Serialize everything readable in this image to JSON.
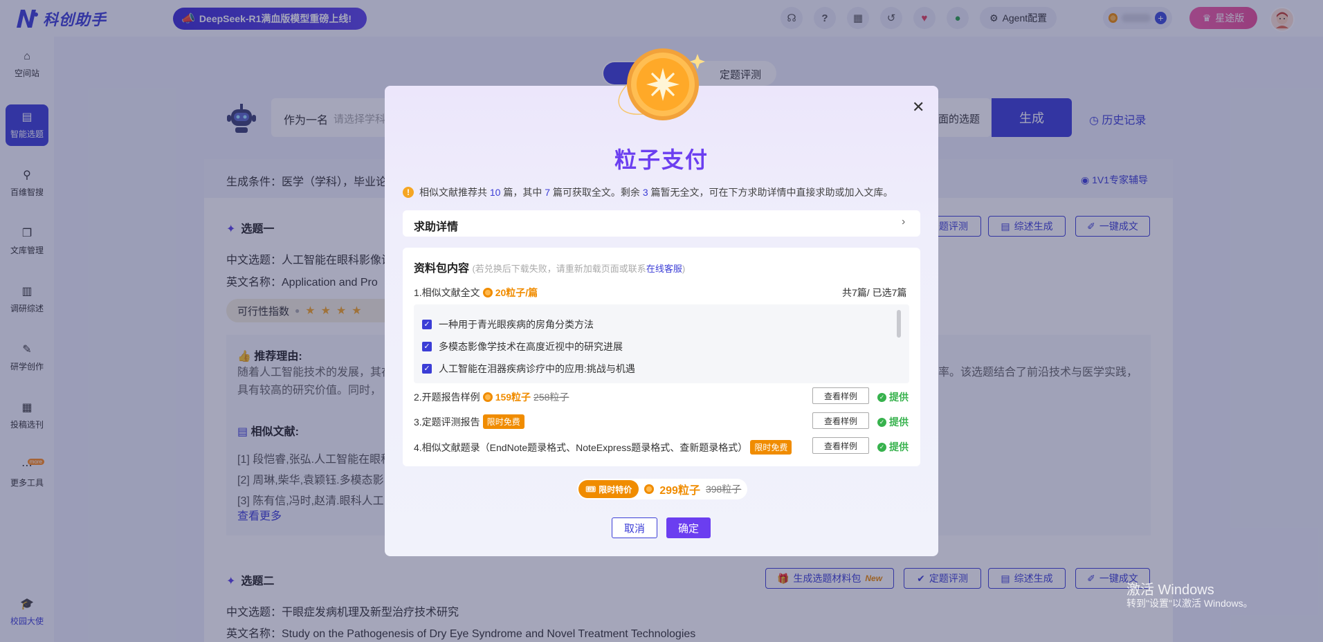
{
  "app": {
    "name": "科创助手",
    "promo": "DeepSeek-R1满血版模型重磅上线!"
  },
  "topbar": {
    "icons": [
      "headset-icon",
      "help-icon",
      "calendar-icon",
      "history-icon",
      "heart-icon",
      "wechat-icon"
    ],
    "agent_label": "Agent配置",
    "vip_label": "星途版"
  },
  "sidebar": {
    "items": [
      {
        "label": "空间站",
        "icon": "⌂"
      },
      {
        "label": "智能选题",
        "icon": "▤"
      },
      {
        "label": "百维智搜",
        "icon": "⚲"
      },
      {
        "label": "文库管理",
        "icon": "❐"
      },
      {
        "label": "调研综述",
        "icon": "▥"
      },
      {
        "label": "研学创作",
        "icon": "✎"
      },
      {
        "label": "投稿选刊",
        "icon": "▦"
      },
      {
        "label": "更多工具",
        "icon": "⋯"
      },
      {
        "label": "校园大使",
        "icon": "🎓"
      }
    ],
    "more_tag": "more"
  },
  "page": {
    "toggle_label": "定题评测",
    "role_prefix": "作为一名",
    "role_placeholder": "请选择学科",
    "search_tail": "面的选题",
    "generate_label": "生成",
    "history_label": "历史记录",
    "condition": "生成条件：医学（学科），毕业论",
    "expert": "1V1专家辅导",
    "topic1": {
      "title": "选题一",
      "cn_prefix": "中文选题：人工智能在眼科影像诊",
      "en_prefix": "英文名称：Application and Pro",
      "feasibility": "可行性指数",
      "reason_title": "推荐理由:",
      "reason_line1": "随着人工智能技术的发展，其在",
      "reason_line1_tail": "率。该选题结合了前沿技术与医学实践，",
      "reason_line2": "具有较高的研究价值。同时，",
      "similar_title": "相似文献:",
      "refs": [
        "[1] 段恺睿,张弘.人工智能在眼科",
        "[2] 周琳,柴华,袁颖钰.多模态影",
        "[3] 陈有信,冯时,赵清.眼科人工"
      ],
      "more": "查看更多",
      "actions": [
        "题评测",
        "综述生成",
        "一键成文"
      ]
    },
    "topic2": {
      "title": "选题二",
      "cn": "中文选题：干眼症发病机理及新型治疗技术研究",
      "en": "英文名称：Study on the Pathogenesis of Dry Eye Syndrome and Novel Treatment Technologies",
      "actions": [
        "生成选题材料包",
        "定题评测",
        "综述生成",
        "一键成文"
      ],
      "new_tag": "New"
    },
    "watermark_title": "激活 Windows",
    "watermark_sub": "转到\"设置\"以激活 Windows。"
  },
  "modal": {
    "title": "粒子支付",
    "notice": {
      "p1": "相似文献推荐共",
      "total": "10",
      "p2": "篇，其中",
      "full": "7",
      "p3": "篇可获取全文。剩余",
      "rest": "3",
      "p4": "篇暂无全文，可在下方求助详情中直接求助或加入文库。"
    },
    "help_label": "求助详情",
    "pack_title": "资料包内容",
    "pack_hint_pre": "(若兑换后下载失败，请重新加载页面或联系",
    "pack_hint_link": "在线客服",
    "pack_hint_post": ")",
    "item1": {
      "label": "1.相似文献全文",
      "price": "20粒子/篇",
      "count": "共7篇/ 已选7篇"
    },
    "papers": [
      "一种用于青光眼疾病的房角分类方法",
      "多模态影像学技术在高度近视中的研究进展",
      "人工智能在泪器疾病诊疗中的应用:挑战与机遇"
    ],
    "item2": {
      "label": "2.开题报告样例",
      "price": "159粒子",
      "old": "258粒子"
    },
    "item3": {
      "label": "3.定题评测报告",
      "tag": "限时免费"
    },
    "item4": {
      "label": "4.相似文献题录（EndNote题录格式、NoteExpress题录格式、查新题录格式）",
      "tag": "限时免费"
    },
    "sample_label": "查看样例",
    "provide_label": "提供",
    "promo_label": "限时特价",
    "price_now": "299粒子",
    "price_old": "398粒子",
    "cancel_label": "取消",
    "ok_label": "确定"
  },
  "colors": {
    "accent": "#3b3dd6",
    "title_purple": "#6b3ef0",
    "orange": "#f08c00",
    "green": "#37b24d"
  }
}
